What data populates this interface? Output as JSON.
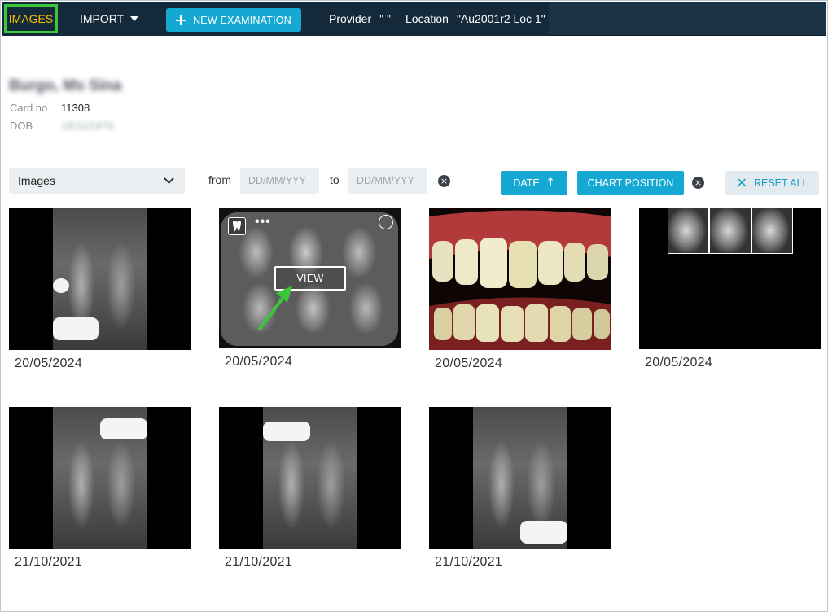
{
  "topbar": {
    "images_tab": "IMAGES",
    "import_tab": "IMPORT",
    "new_exam": "NEW EXAMINATION",
    "provider_label": "Provider",
    "provider_value": "\" \"",
    "location_label": "Location",
    "location_value": "\"Au2001r2 Loc 1\""
  },
  "patient": {
    "name": "Burgo, Ms Sina",
    "card_label": "Card no",
    "card_value": "11308",
    "dob_label": "DOB",
    "dob_value": "18/11/1970"
  },
  "filters": {
    "type_select": "Images",
    "from_label": "from",
    "to_label": "to",
    "from_placeholder": "DD/MM/YYY",
    "to_placeholder": "DD/MM/YYY",
    "sort_date": "DATE",
    "chart_position": "CHART POSITION",
    "reset_all": "RESET ALL"
  },
  "hover": {
    "view_label": "VIEW",
    "more_glyph": "•••"
  },
  "colors": {
    "topbar": "#14293a",
    "accent": "#14a8d2",
    "highlight": "#3bc63b",
    "tab_text": "#f6c200"
  },
  "gallery": [
    {
      "date": "20/05/2024",
      "kind": "periapical-xray"
    },
    {
      "date": "20/05/2024",
      "kind": "bitewing-xray"
    },
    {
      "date": "20/05/2024",
      "kind": "intraoral-photo"
    },
    {
      "date": "20/05/2024",
      "kind": "cephalometric-xray-series"
    },
    {
      "date": "21/10/2021",
      "kind": "periapical-xray"
    },
    {
      "date": "21/10/2021",
      "kind": "periapical-xray"
    },
    {
      "date": "21/10/2021",
      "kind": "periapical-xray"
    }
  ]
}
